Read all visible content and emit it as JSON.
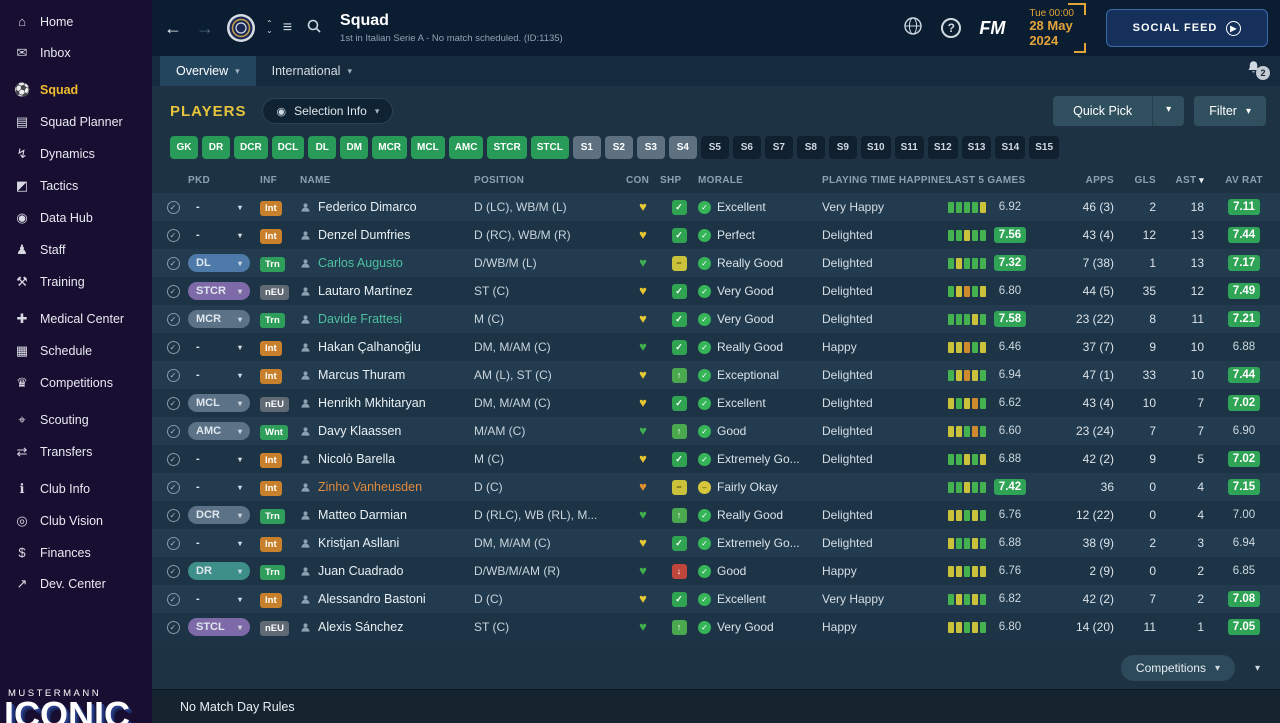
{
  "topbar": {
    "title": "Squad",
    "subtitle": "1st in Italian Serie A - No match scheduled. (ID:1135)",
    "date": {
      "line1": "Tue 00:00",
      "line2": "28 May",
      "line3": "2024"
    },
    "fm_label": "FM",
    "social_feed_label": "SOCIAL FEED"
  },
  "notification_count": "2",
  "tabs": [
    {
      "label": "Overview",
      "active": true
    },
    {
      "label": "International",
      "active": false
    }
  ],
  "sidebar": {
    "logo_top": "MUSTERMANN",
    "logo_bottom": "ICONIC",
    "items": [
      {
        "label": "Home",
        "icon": "home-icon",
        "glyph": "⌂",
        "group": 1
      },
      {
        "label": "Inbox",
        "icon": "inbox-icon",
        "glyph": "✉",
        "group": 1
      },
      {
        "label": "Squad",
        "icon": "squad-icon",
        "glyph": "⚽",
        "group": 2,
        "active": true
      },
      {
        "label": "Squad Planner",
        "icon": "squad-planner-icon",
        "glyph": "▤",
        "group": 2
      },
      {
        "label": "Dynamics",
        "icon": "dynamics-icon",
        "glyph": "↯",
        "group": 2
      },
      {
        "label": "Tactics",
        "icon": "tactics-icon",
        "glyph": "◩",
        "group": 2
      },
      {
        "label": "Data Hub",
        "icon": "data-hub-icon",
        "glyph": "◉",
        "group": 2
      },
      {
        "label": "Staff",
        "icon": "staff-icon",
        "glyph": "♟",
        "group": 2
      },
      {
        "label": "Training",
        "icon": "training-icon",
        "glyph": "⚒",
        "group": 2
      },
      {
        "label": "Medical Center",
        "icon": "medical-center-icon",
        "glyph": "✚",
        "group": 3
      },
      {
        "label": "Schedule",
        "icon": "schedule-icon",
        "glyph": "▦",
        "group": 3
      },
      {
        "label": "Competitions",
        "icon": "competitions-icon",
        "glyph": "♛",
        "group": 3
      },
      {
        "label": "Scouting",
        "icon": "scouting-icon",
        "glyph": "⌖",
        "group": 4
      },
      {
        "label": "Transfers",
        "icon": "transfers-icon",
        "glyph": "⇄",
        "group": 4
      },
      {
        "label": "Club Info",
        "icon": "club-info-icon",
        "glyph": "ℹ",
        "group": 5
      },
      {
        "label": "Club Vision",
        "icon": "club-vision-icon",
        "glyph": "◎",
        "group": 5
      },
      {
        "label": "Finances",
        "icon": "finances-icon",
        "glyph": "$",
        "group": 5
      },
      {
        "label": "Dev. Center",
        "icon": "dev-center-icon",
        "glyph": "↗",
        "group": 5
      }
    ]
  },
  "players_header": {
    "title": "PLAYERS",
    "selection_info_label": "Selection Info",
    "quick_pick_label": "Quick Pick",
    "filter_label": "Filter"
  },
  "position_filters": [
    {
      "label": "GK",
      "style": "green"
    },
    {
      "label": "DR",
      "style": "green"
    },
    {
      "label": "DCR",
      "style": "green"
    },
    {
      "label": "DCL",
      "style": "green"
    },
    {
      "label": "DL",
      "style": "green"
    },
    {
      "label": "DM",
      "style": "green"
    },
    {
      "label": "MCR",
      "style": "green"
    },
    {
      "label": "MCL",
      "style": "green"
    },
    {
      "label": "AMC",
      "style": "green"
    },
    {
      "label": "STCR",
      "style": "green"
    },
    {
      "label": "STCL",
      "style": "green"
    },
    {
      "label": "S1",
      "style": "slate"
    },
    {
      "label": "S2",
      "style": "slate"
    },
    {
      "label": "S3",
      "style": "slate"
    },
    {
      "label": "S4",
      "style": "slate"
    },
    {
      "label": "S5",
      "style": "dark"
    },
    {
      "label": "S6",
      "style": "dark"
    },
    {
      "label": "S7",
      "style": "dark"
    },
    {
      "label": "S8",
      "style": "dark"
    },
    {
      "label": "S9",
      "style": "dark"
    },
    {
      "label": "S10",
      "style": "dark"
    },
    {
      "label": "S11",
      "style": "dark"
    },
    {
      "label": "S12",
      "style": "dark"
    },
    {
      "label": "S13",
      "style": "dark"
    },
    {
      "label": "S14",
      "style": "dark"
    },
    {
      "label": "S15",
      "style": "dark"
    }
  ],
  "table": {
    "columns": [
      {
        "key": "pkd",
        "label": "PKD"
      },
      {
        "key": "inf",
        "label": "INF"
      },
      {
        "key": "name",
        "label": "NAME"
      },
      {
        "key": "position",
        "label": "POSITION"
      },
      {
        "key": "con",
        "label": "CON"
      },
      {
        "key": "shp",
        "label": "SHP"
      },
      {
        "key": "morale",
        "label": "MORALE"
      },
      {
        "key": "pth",
        "label": "PLAYING TIME HAPPINESS"
      },
      {
        "key": "last5",
        "label": "LAST 5 GAMES"
      },
      {
        "key": "apps",
        "label": "APPS"
      },
      {
        "key": "gls",
        "label": "GLS"
      },
      {
        "key": "ast",
        "label": "AST",
        "sorted": true
      },
      {
        "key": "avrat",
        "label": "AV RAT"
      }
    ]
  },
  "players": [
    {
      "pkd": "-",
      "inf": "Int",
      "name": "Federico Dimarco",
      "position": "D (LC), WB/M (L)",
      "con": "yellow",
      "shp": "fit",
      "morale": "Excellent",
      "playing_time": "Very Happy",
      "last5_bars": [
        "g",
        "g",
        "g",
        "g",
        "y"
      ],
      "last5_rating": "6.92",
      "last5_badge": false,
      "apps": "46 (3)",
      "gls": "2",
      "ast": "18",
      "av_rat": "7.11",
      "av_rat_badge": true
    },
    {
      "pkd": "-",
      "inf": "Int",
      "name": "Denzel Dumfries",
      "position": "D (RC), WB/M (R)",
      "con": "yellow",
      "shp": "fit",
      "morale": "Perfect",
      "playing_time": "Delighted",
      "last5_bars": [
        "g",
        "g",
        "y",
        "g",
        "g"
      ],
      "last5_rating": "7.56",
      "last5_badge": true,
      "apps": "43 (4)",
      "gls": "12",
      "ast": "13",
      "av_rat": "7.44",
      "av_rat_badge": true
    },
    {
      "pkd": "DL",
      "pkd_color": "blue",
      "inf": "Trn",
      "name": "Carlos Augusto",
      "name_color": "teal",
      "position": "D/WB/M (L)",
      "con": "green",
      "shp": "minus",
      "morale": "Really Good",
      "playing_time": "Delighted",
      "last5_bars": [
        "g",
        "y",
        "g",
        "g",
        "g"
      ],
      "last5_rating": "7.32",
      "last5_badge": true,
      "apps": "7 (38)",
      "gls": "1",
      "ast": "13",
      "av_rat": "7.17",
      "av_rat_badge": true
    },
    {
      "pkd": "STCR",
      "pkd_color": "purple",
      "inf": "nEU",
      "name": "Lautaro Martínez",
      "position": "ST (C)",
      "con": "yellow",
      "shp": "fit",
      "morale": "Very Good",
      "playing_time": "Delighted",
      "last5_bars": [
        "g",
        "y",
        "o",
        "g",
        "y"
      ],
      "last5_rating": "6.80",
      "last5_badge": false,
      "apps": "44 (5)",
      "gls": "35",
      "ast": "12",
      "av_rat": "7.49",
      "av_rat_badge": true
    },
    {
      "pkd": "MCR",
      "pkd_color": "slate",
      "inf": "Trn",
      "name": "Davide Frattesi",
      "name_color": "teal",
      "position": "M (C)",
      "con": "yellow",
      "shp": "fit",
      "morale": "Very Good",
      "playing_time": "Delighted",
      "last5_bars": [
        "g",
        "g",
        "g",
        "y",
        "g"
      ],
      "last5_rating": "7.58",
      "last5_badge": true,
      "apps": "23 (22)",
      "gls": "8",
      "ast": "11",
      "av_rat": "7.21",
      "av_rat_badge": true
    },
    {
      "pkd": "-",
      "inf": "Int",
      "name": "Hakan Çalhanoğlu",
      "position": "DM, M/AM (C)",
      "con": "green",
      "shp": "fit",
      "morale": "Really Good",
      "playing_time": "Happy",
      "last5_bars": [
        "y",
        "y",
        "o",
        "g",
        "y"
      ],
      "last5_rating": "6.46",
      "last5_badge": false,
      "apps": "37 (7)",
      "gls": "9",
      "ast": "10",
      "av_rat": "6.88",
      "av_rat_badge": false
    },
    {
      "pkd": "-",
      "inf": "Int",
      "name": "Marcus Thuram",
      "position": "AM (L), ST (C)",
      "con": "yellow",
      "shp": "up",
      "morale": "Exceptional",
      "playing_time": "Delighted",
      "last5_bars": [
        "g",
        "y",
        "o",
        "y",
        "g"
      ],
      "last5_rating": "6.94",
      "last5_badge": false,
      "apps": "47 (1)",
      "gls": "33",
      "ast": "10",
      "av_rat": "7.44",
      "av_rat_badge": true
    },
    {
      "pkd": "MCL",
      "pkd_color": "slate",
      "inf": "nEU",
      "name": "Henrikh Mkhitaryan",
      "position": "DM, M/AM (C)",
      "con": "yellow",
      "shp": "fit",
      "morale": "Excellent",
      "playing_time": "Delighted",
      "last5_bars": [
        "y",
        "g",
        "y",
        "o",
        "g"
      ],
      "last5_rating": "6.62",
      "last5_badge": false,
      "apps": "43 (4)",
      "gls": "10",
      "ast": "7",
      "av_rat": "7.02",
      "av_rat_badge": true
    },
    {
      "pkd": "AMC",
      "pkd_color": "slate",
      "inf": "Wnt",
      "name": "Davy Klaassen",
      "position": "M/AM (C)",
      "con": "green",
      "shp": "up",
      "morale": "Good",
      "playing_time": "Delighted",
      "last5_bars": [
        "y",
        "y",
        "g",
        "o",
        "g"
      ],
      "last5_rating": "6.60",
      "last5_badge": false,
      "apps": "23 (24)",
      "gls": "7",
      "ast": "7",
      "av_rat": "6.90",
      "av_rat_badge": false
    },
    {
      "pkd": "-",
      "inf": "Int",
      "name": "Nicolò Barella",
      "position": "M (C)",
      "con": "yellow",
      "shp": "fit",
      "morale": "Extremely Go...",
      "playing_time": "Delighted",
      "last5_bars": [
        "g",
        "g",
        "y",
        "g",
        "y"
      ],
      "last5_rating": "6.88",
      "last5_badge": false,
      "apps": "42 (2)",
      "gls": "9",
      "ast": "5",
      "av_rat": "7.02",
      "av_rat_badge": true
    },
    {
      "pkd": "-",
      "inf": "Int",
      "name": "Zinho Vanheusden",
      "name_color": "orange",
      "position": "D (C)",
      "con": "orange",
      "shp": "minus",
      "morale": "Fairly Okay",
      "morale_color": "yellow",
      "playing_time": "",
      "last5_bars": [
        "g",
        "g",
        "y",
        "g",
        "g"
      ],
      "last5_rating": "7.42",
      "last5_badge": true,
      "apps": "36",
      "gls": "0",
      "ast": "4",
      "av_rat": "7.15",
      "av_rat_badge": true
    },
    {
      "pkd": "DCR",
      "pkd_color": "slate",
      "inf": "Trn",
      "name": "Matteo Darmian",
      "position": "D (RLC), WB (RL), M...",
      "con": "green",
      "shp": "up",
      "morale": "Really Good",
      "playing_time": "Delighted",
      "last5_bars": [
        "y",
        "y",
        "g",
        "y",
        "g"
      ],
      "last5_rating": "6.76",
      "last5_badge": false,
      "apps": "12 (22)",
      "gls": "0",
      "ast": "4",
      "av_rat": "7.00",
      "av_rat_badge": false
    },
    {
      "pkd": "-",
      "inf": "Int",
      "name": "Kristjan Asllani",
      "position": "DM, M/AM (C)",
      "con": "yellow",
      "shp": "fit",
      "morale": "Extremely Go...",
      "playing_time": "Delighted",
      "last5_bars": [
        "y",
        "g",
        "g",
        "y",
        "g"
      ],
      "last5_rating": "6.88",
      "last5_badge": false,
      "apps": "38 (9)",
      "gls": "2",
      "ast": "3",
      "av_rat": "6.94",
      "av_rat_badge": false
    },
    {
      "pkd": "DR",
      "pkd_color": "teal",
      "inf": "Trn",
      "name": "Juan Cuadrado",
      "position": "D/WB/M/AM (R)",
      "con": "green",
      "shp": "down",
      "morale": "Good",
      "playing_time": "Happy",
      "last5_bars": [
        "y",
        "y",
        "g",
        "y",
        "y"
      ],
      "last5_rating": "6.76",
      "last5_badge": false,
      "apps": "2 (9)",
      "gls": "0",
      "ast": "2",
      "av_rat": "6.85",
      "av_rat_badge": false
    },
    {
      "pkd": "-",
      "inf": "Int",
      "name": "Alessandro Bastoni",
      "position": "D (C)",
      "con": "yellow",
      "shp": "fit",
      "morale": "Excellent",
      "playing_time": "Very Happy",
      "last5_bars": [
        "g",
        "y",
        "g",
        "y",
        "g"
      ],
      "last5_rating": "6.82",
      "last5_badge": false,
      "apps": "42 (2)",
      "gls": "7",
      "ast": "2",
      "av_rat": "7.08",
      "av_rat_badge": true
    },
    {
      "pkd": "STCL",
      "pkd_color": "purple",
      "inf": "nEU",
      "name": "Alexis Sánchez",
      "position": "ST (C)",
      "con": "green",
      "shp": "up",
      "morale": "Very Good",
      "playing_time": "Happy",
      "last5_bars": [
        "y",
        "y",
        "g",
        "y",
        "g"
      ],
      "last5_rating": "6.80",
      "last5_badge": false,
      "apps": "14 (20)",
      "gls": "11",
      "ast": "1",
      "av_rat": "7.05",
      "av_rat_badge": true
    }
  ],
  "footer": {
    "competitions_label": "Competitions",
    "bottom_text": "No Match Day Rules"
  },
  "colors": {
    "accent_yellow": "#e8c43c",
    "rating_badge": "#2fa356",
    "pkd": {
      "blue": "#4d7aa8",
      "purple": "#7e6aa8",
      "slate": "#5c7287",
      "teal": "#3e8e8a"
    },
    "inf": {
      "Int": "#c8802c",
      "Trn": "#2f9e5a",
      "nEU": "#5f6a75",
      "Wnt": "#2f9e5a"
    },
    "name": {
      "teal": "#4fc0a0",
      "orange": "#e08a3c"
    },
    "heart": {
      "yellow": "#e8c832",
      "green": "#3fae4f",
      "orange": "#e0902e"
    },
    "bars": {
      "g": "#44b24e",
      "y": "#c9c23a",
      "o": "#d08a2e",
      "r": "#c84a3a"
    },
    "shp": {
      "fit": {
        "bg": "#2fa34f",
        "glyph": "✓"
      },
      "up": {
        "bg": "#4aa84e",
        "glyph": "↑"
      },
      "minus": {
        "bg": "#c9c23a",
        "glyph": "−",
        "fg": "#4a4200"
      },
      "down": {
        "bg": "#c0453a",
        "glyph": "↓"
      }
    },
    "morale": {
      "green": "#35b558",
      "yellow": "#d8c63a"
    }
  }
}
